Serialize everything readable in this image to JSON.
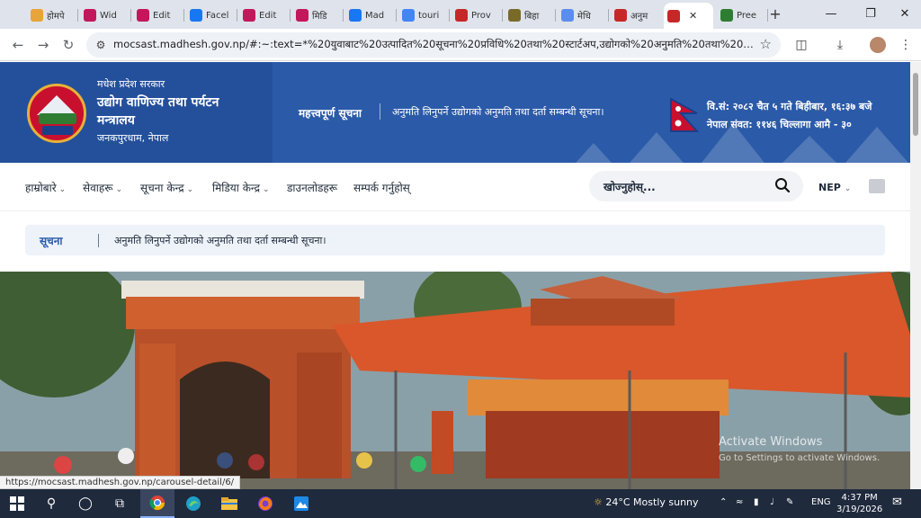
{
  "browser": {
    "tabs": [
      {
        "label": "होमपे",
        "icon": "page-icon",
        "color": "#e8a33a"
      },
      {
        "label": "Wid",
        "icon": "mk-icon",
        "color": "#c2185b"
      },
      {
        "label": "Edit",
        "icon": "mk-icon",
        "color": "#c2185b"
      },
      {
        "label": "Facel",
        "icon": "facebook-icon",
        "color": "#1877f2"
      },
      {
        "label": "Edit",
        "icon": "mk-icon",
        "color": "#c2185b"
      },
      {
        "label": "मिडि",
        "icon": "mk-icon",
        "color": "#c2185b"
      },
      {
        "label": "Mad",
        "icon": "facebook-icon",
        "color": "#1877f2"
      },
      {
        "label": "touri",
        "icon": "google-icon",
        "color": "#4285f4"
      },
      {
        "label": "Prov",
        "icon": "gov-icon",
        "color": "#c62828"
      },
      {
        "label": "बिहा",
        "icon": "page-icon",
        "color": "#7a6a2a"
      },
      {
        "label": "मेधि",
        "icon": "chart-icon",
        "color": "#5b8def"
      },
      {
        "label": "अनुम",
        "icon": "gov-icon",
        "color": "#c62828"
      },
      {
        "label": "",
        "icon": "gov-icon",
        "color": "#c62828"
      },
      {
        "label": "Pree",
        "icon": "page-icon",
        "color": "#2e7d32"
      }
    ],
    "url": "mocsast.madhesh.gov.np/#:~:text=*%20युवाबाट%20उत्पादित%20सूचना%20प्रविधि%20तथा%20स्टार्टअप,उद्योगको%20अनुमति%20तथा%20दर्ता%20सम्बन्..."
  },
  "site": {
    "org_super": "मधेश प्रदेश सरकार",
    "org_name": "उद्योग वाणिज्य तथा पर्यटन मन्त्रालय",
    "org_location": "जनकपुरधाम, नेपाल",
    "header_notice_title": "महत्त्वपूर्ण सूचना",
    "header_notice_text": "अनुमति लिनुपर्ने उद्योगको अनुमति तथा दर्ता सम्बन्धी सूचना।",
    "date_line1": "वि.सं: २०८२ चैत ५ गते बिहीबार, १६:३७ बजे",
    "date_line2": "नेपाल संवत: ११४६ चिल्लागा आमै - ३०"
  },
  "nav": {
    "items": [
      "हाम्रोबारे",
      "सेवाहरू",
      "सूचना केन्द्र",
      "मिडिया केन्द्र",
      "डाउनलोडहरू",
      "सम्पर्क गर्नुहोस्"
    ],
    "search_placeholder": "खोज्नुहोस्...",
    "language": "NEP"
  },
  "notice": {
    "label": "सूचना",
    "text": "अनुमति लिनुपर्ने उद्योगको अनुमति तथा दर्ता सम्बन्धी सूचना।"
  },
  "watermark": {
    "line1": "Activate Windows",
    "line2": "Go to Settings to activate Windows."
  },
  "status_url": "https://mocsast.madhesh.gov.np/carousel-detail/6/",
  "taskbar": {
    "weather": "24°C  Mostly sunny",
    "lang": "ENG",
    "time": "4:37 PM",
    "date": "3/19/2026"
  },
  "colors": {
    "header_blue": "#2b5aa8",
    "nepal_red": "#c8102e",
    "notice_bg": "#eef3fa"
  }
}
